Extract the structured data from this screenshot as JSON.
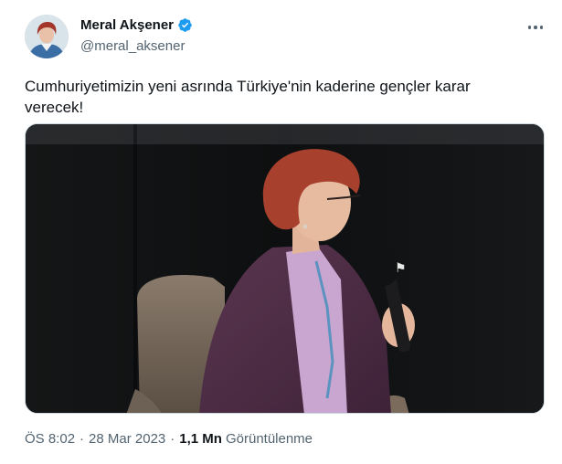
{
  "author": {
    "display_name": "Meral Akşener",
    "handle": "@meral_aksener",
    "verified": true
  },
  "tweet": {
    "text": "Cumhuriyetimizin yeni asrında Türkiye'nin kaderine gençler karar verecek!"
  },
  "meta": {
    "time": "ÖS 8:02",
    "separator": "·",
    "date": "28 Mar 2023",
    "views_count": "1,1 Mn",
    "views_label": "Görüntülenme"
  },
  "colors": {
    "verified_badge": "#1d9bf0",
    "secondary_text": "#536471",
    "primary_text": "#0f1419"
  },
  "icons": {
    "verified": "verified-badge-icon",
    "more": "more-options-icon"
  }
}
